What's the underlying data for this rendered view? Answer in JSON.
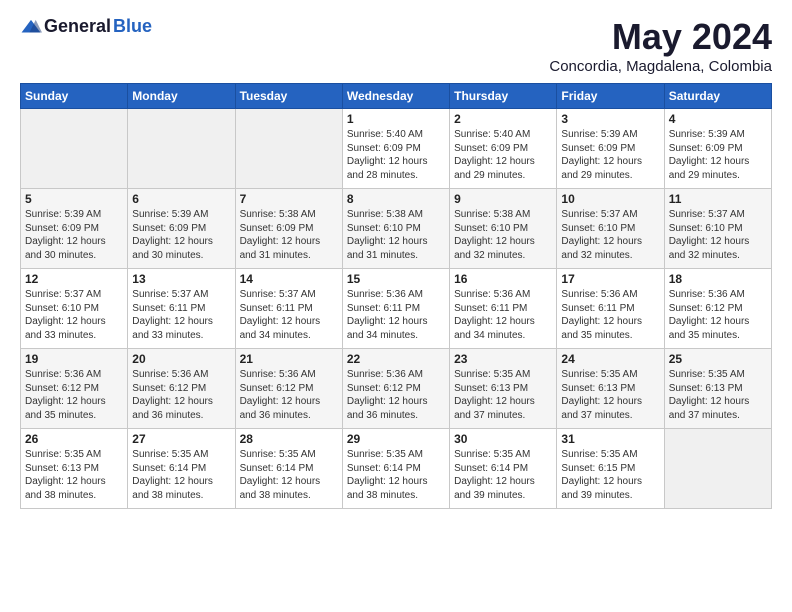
{
  "logo": {
    "general": "General",
    "blue": "Blue"
  },
  "header": {
    "month_title": "May 2024",
    "subtitle": "Concordia, Magdalena, Colombia"
  },
  "days_of_week": [
    "Sunday",
    "Monday",
    "Tuesday",
    "Wednesday",
    "Thursday",
    "Friday",
    "Saturday"
  ],
  "weeks": [
    [
      {
        "day": "",
        "info": ""
      },
      {
        "day": "",
        "info": ""
      },
      {
        "day": "",
        "info": ""
      },
      {
        "day": "1",
        "info": "Sunrise: 5:40 AM\nSunset: 6:09 PM\nDaylight: 12 hours\nand 28 minutes."
      },
      {
        "day": "2",
        "info": "Sunrise: 5:40 AM\nSunset: 6:09 PM\nDaylight: 12 hours\nand 29 minutes."
      },
      {
        "day": "3",
        "info": "Sunrise: 5:39 AM\nSunset: 6:09 PM\nDaylight: 12 hours\nand 29 minutes."
      },
      {
        "day": "4",
        "info": "Sunrise: 5:39 AM\nSunset: 6:09 PM\nDaylight: 12 hours\nand 29 minutes."
      }
    ],
    [
      {
        "day": "5",
        "info": "Sunrise: 5:39 AM\nSunset: 6:09 PM\nDaylight: 12 hours\nand 30 minutes."
      },
      {
        "day": "6",
        "info": "Sunrise: 5:39 AM\nSunset: 6:09 PM\nDaylight: 12 hours\nand 30 minutes."
      },
      {
        "day": "7",
        "info": "Sunrise: 5:38 AM\nSunset: 6:09 PM\nDaylight: 12 hours\nand 31 minutes."
      },
      {
        "day": "8",
        "info": "Sunrise: 5:38 AM\nSunset: 6:10 PM\nDaylight: 12 hours\nand 31 minutes."
      },
      {
        "day": "9",
        "info": "Sunrise: 5:38 AM\nSunset: 6:10 PM\nDaylight: 12 hours\nand 32 minutes."
      },
      {
        "day": "10",
        "info": "Sunrise: 5:37 AM\nSunset: 6:10 PM\nDaylight: 12 hours\nand 32 minutes."
      },
      {
        "day": "11",
        "info": "Sunrise: 5:37 AM\nSunset: 6:10 PM\nDaylight: 12 hours\nand 32 minutes."
      }
    ],
    [
      {
        "day": "12",
        "info": "Sunrise: 5:37 AM\nSunset: 6:10 PM\nDaylight: 12 hours\nand 33 minutes."
      },
      {
        "day": "13",
        "info": "Sunrise: 5:37 AM\nSunset: 6:11 PM\nDaylight: 12 hours\nand 33 minutes."
      },
      {
        "day": "14",
        "info": "Sunrise: 5:37 AM\nSunset: 6:11 PM\nDaylight: 12 hours\nand 34 minutes."
      },
      {
        "day": "15",
        "info": "Sunrise: 5:36 AM\nSunset: 6:11 PM\nDaylight: 12 hours\nand 34 minutes."
      },
      {
        "day": "16",
        "info": "Sunrise: 5:36 AM\nSunset: 6:11 PM\nDaylight: 12 hours\nand 34 minutes."
      },
      {
        "day": "17",
        "info": "Sunrise: 5:36 AM\nSunset: 6:11 PM\nDaylight: 12 hours\nand 35 minutes."
      },
      {
        "day": "18",
        "info": "Sunrise: 5:36 AM\nSunset: 6:12 PM\nDaylight: 12 hours\nand 35 minutes."
      }
    ],
    [
      {
        "day": "19",
        "info": "Sunrise: 5:36 AM\nSunset: 6:12 PM\nDaylight: 12 hours\nand 35 minutes."
      },
      {
        "day": "20",
        "info": "Sunrise: 5:36 AM\nSunset: 6:12 PM\nDaylight: 12 hours\nand 36 minutes."
      },
      {
        "day": "21",
        "info": "Sunrise: 5:36 AM\nSunset: 6:12 PM\nDaylight: 12 hours\nand 36 minutes."
      },
      {
        "day": "22",
        "info": "Sunrise: 5:36 AM\nSunset: 6:12 PM\nDaylight: 12 hours\nand 36 minutes."
      },
      {
        "day": "23",
        "info": "Sunrise: 5:35 AM\nSunset: 6:13 PM\nDaylight: 12 hours\nand 37 minutes."
      },
      {
        "day": "24",
        "info": "Sunrise: 5:35 AM\nSunset: 6:13 PM\nDaylight: 12 hours\nand 37 minutes."
      },
      {
        "day": "25",
        "info": "Sunrise: 5:35 AM\nSunset: 6:13 PM\nDaylight: 12 hours\nand 37 minutes."
      }
    ],
    [
      {
        "day": "26",
        "info": "Sunrise: 5:35 AM\nSunset: 6:13 PM\nDaylight: 12 hours\nand 38 minutes."
      },
      {
        "day": "27",
        "info": "Sunrise: 5:35 AM\nSunset: 6:14 PM\nDaylight: 12 hours\nand 38 minutes."
      },
      {
        "day": "28",
        "info": "Sunrise: 5:35 AM\nSunset: 6:14 PM\nDaylight: 12 hours\nand 38 minutes."
      },
      {
        "day": "29",
        "info": "Sunrise: 5:35 AM\nSunset: 6:14 PM\nDaylight: 12 hours\nand 38 minutes."
      },
      {
        "day": "30",
        "info": "Sunrise: 5:35 AM\nSunset: 6:14 PM\nDaylight: 12 hours\nand 39 minutes."
      },
      {
        "day": "31",
        "info": "Sunrise: 5:35 AM\nSunset: 6:15 PM\nDaylight: 12 hours\nand 39 minutes."
      },
      {
        "day": "",
        "info": ""
      }
    ]
  ]
}
